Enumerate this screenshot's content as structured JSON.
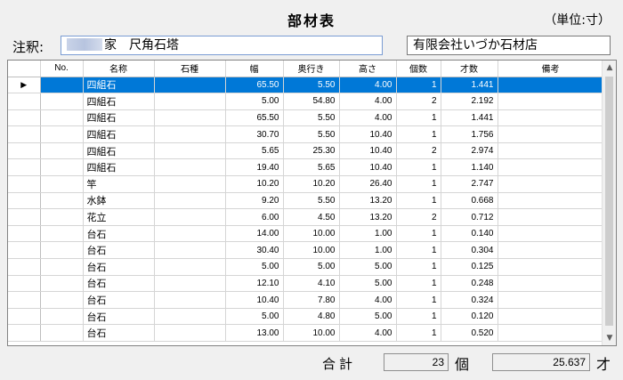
{
  "header": {
    "title": "部材表",
    "unit": "（単位:寸）"
  },
  "note": {
    "label": "注釈:",
    "value": "家　尺角石塔"
  },
  "shop": {
    "name": "有限会社いづか石材店"
  },
  "grid": {
    "columns": [
      "No.",
      "名称",
      "石種",
      "幅",
      "奥行き",
      "高さ",
      "個数",
      "才数",
      "備考"
    ],
    "selected_row": 0,
    "rows": [
      {
        "no": "",
        "name": "四組石",
        "stone": "",
        "width": "65.50",
        "depth": "5.50",
        "height": "4.00",
        "count": "1",
        "sai": "1.441",
        "note": ""
      },
      {
        "no": "",
        "name": "四組石",
        "stone": "",
        "width": "5.00",
        "depth": "54.80",
        "height": "4.00",
        "count": "2",
        "sai": "2.192",
        "note": ""
      },
      {
        "no": "",
        "name": "四組石",
        "stone": "",
        "width": "65.50",
        "depth": "5.50",
        "height": "4.00",
        "count": "1",
        "sai": "1.441",
        "note": ""
      },
      {
        "no": "",
        "name": "四組石",
        "stone": "",
        "width": "30.70",
        "depth": "5.50",
        "height": "10.40",
        "count": "1",
        "sai": "1.756",
        "note": ""
      },
      {
        "no": "",
        "name": "四組石",
        "stone": "",
        "width": "5.65",
        "depth": "25.30",
        "height": "10.40",
        "count": "2",
        "sai": "2.974",
        "note": ""
      },
      {
        "no": "",
        "name": "四組石",
        "stone": "",
        "width": "19.40",
        "depth": "5.65",
        "height": "10.40",
        "count": "1",
        "sai": "1.140",
        "note": ""
      },
      {
        "no": "",
        "name": "竿",
        "stone": "",
        "width": "10.20",
        "depth": "10.20",
        "height": "26.40",
        "count": "1",
        "sai": "2.747",
        "note": ""
      },
      {
        "no": "",
        "name": "水鉢",
        "stone": "",
        "width": "9.20",
        "depth": "5.50",
        "height": "13.20",
        "count": "1",
        "sai": "0.668",
        "note": ""
      },
      {
        "no": "",
        "name": "花立",
        "stone": "",
        "width": "6.00",
        "depth": "4.50",
        "height": "13.20",
        "count": "2",
        "sai": "0.712",
        "note": ""
      },
      {
        "no": "",
        "name": "台石",
        "stone": "",
        "width": "14.00",
        "depth": "10.00",
        "height": "1.00",
        "count": "1",
        "sai": "0.140",
        "note": ""
      },
      {
        "no": "",
        "name": "台石",
        "stone": "",
        "width": "30.40",
        "depth": "10.00",
        "height": "1.00",
        "count": "1",
        "sai": "0.304",
        "note": ""
      },
      {
        "no": "",
        "name": "台石",
        "stone": "",
        "width": "5.00",
        "depth": "5.00",
        "height": "5.00",
        "count": "1",
        "sai": "0.125",
        "note": ""
      },
      {
        "no": "",
        "name": "台石",
        "stone": "",
        "width": "12.10",
        "depth": "4.10",
        "height": "5.00",
        "count": "1",
        "sai": "0.248",
        "note": ""
      },
      {
        "no": "",
        "name": "台石",
        "stone": "",
        "width": "10.40",
        "depth": "7.80",
        "height": "4.00",
        "count": "1",
        "sai": "0.324",
        "note": ""
      },
      {
        "no": "",
        "name": "台石",
        "stone": "",
        "width": "5.00",
        "depth": "4.80",
        "height": "5.00",
        "count": "1",
        "sai": "0.120",
        "note": ""
      },
      {
        "no": "",
        "name": "台石",
        "stone": "",
        "width": "13.00",
        "depth": "10.00",
        "height": "4.00",
        "count": "1",
        "sai": "0.520",
        "note": ""
      }
    ]
  },
  "totals": {
    "label": "合計",
    "count": "23",
    "count_unit": "個",
    "sai": "25.637",
    "sai_unit": "才"
  },
  "colors": {
    "selection": "#0078d7",
    "background": "#f0f0f0"
  },
  "icons": {
    "row_indicator": "current-row-arrow-icon",
    "scroll_up": "chevron-up-icon",
    "scroll_down": "chevron-down-icon"
  }
}
